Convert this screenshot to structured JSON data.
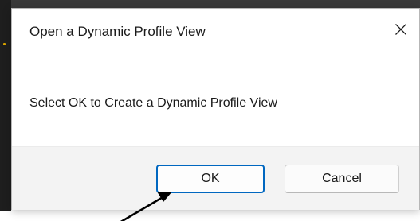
{
  "dialog": {
    "title": "Open a Dynamic Profile View",
    "message": "Select OK to Create a Dynamic Profile View",
    "close_icon": "close-icon",
    "ok_label": "OK",
    "cancel_label": "Cancel"
  },
  "colors": {
    "accent": "#0067c0",
    "footer_bg": "#f3f3f3",
    "annotation_arrow": "#000000"
  }
}
